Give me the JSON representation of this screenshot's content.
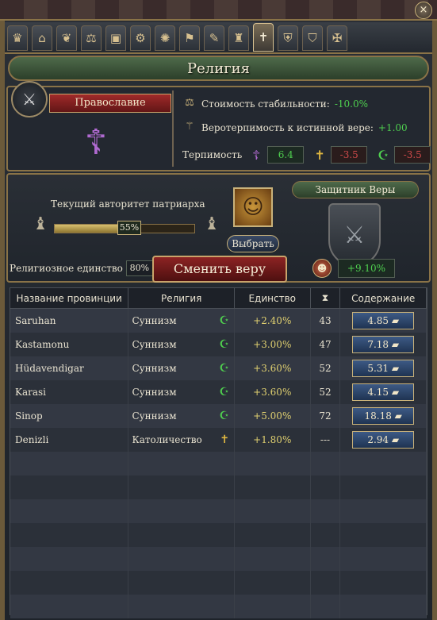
{
  "window": {
    "title": "Религия",
    "close_icon": "×"
  },
  "tabs": [
    {
      "name": "crown-icon",
      "glyph": "♛"
    },
    {
      "name": "court-icon",
      "glyph": "⌂"
    },
    {
      "name": "dove-icon",
      "glyph": "❦"
    },
    {
      "name": "trade-icon",
      "glyph": "⚖"
    },
    {
      "name": "cargo-icon",
      "glyph": "▣"
    },
    {
      "name": "gear-icon",
      "glyph": "⚙"
    },
    {
      "name": "idea-icon",
      "glyph": "✺"
    },
    {
      "name": "flag-icon",
      "glyph": "⚑"
    },
    {
      "name": "scroll-icon",
      "glyph": "✎"
    },
    {
      "name": "estates-icon",
      "glyph": "♜"
    },
    {
      "name": "religion-icon",
      "glyph": "✝",
      "active": true
    },
    {
      "name": "helmet-icon",
      "glyph": "⛨"
    },
    {
      "name": "shield-badge-icon",
      "glyph": "⛉"
    },
    {
      "name": "cross-star-icon",
      "glyph": "✠"
    }
  ],
  "religion": {
    "name": "Православие",
    "icon_glyph": "☦",
    "stability_cost_label": "Стоимость стабильности:",
    "stability_cost_value": "-10.0%",
    "true_faith_tol_label": "Веротерпимость к истинной вере:",
    "true_faith_tol_value": "+1.00",
    "tolerance_label": "Терпимость",
    "tolerances": [
      {
        "glyph": "☦",
        "value": "6.4",
        "color": "#4fd04f",
        "icon_color": "#b06ad0"
      },
      {
        "glyph": "✝",
        "value": "-3.5",
        "color": "#d04a4a",
        "icon_color": "#e0b840"
      },
      {
        "glyph": "☪",
        "value": "-3.5",
        "color": "#d04a4a",
        "icon_color": "#4fd04f"
      }
    ]
  },
  "authority": {
    "label": "Текущий авторитет патриарха",
    "percent": "55%",
    "fill_fraction": 0.55,
    "choose_label": "Выбрать",
    "defender_label": "Защитник Веры"
  },
  "unity": {
    "label": "Религиозное единство",
    "value": "80%",
    "convert_label": "Сменить веру",
    "bonus_value": "+9.10%"
  },
  "table": {
    "headers": {
      "province": "Название провинции",
      "religion": "Религия",
      "unity": "Единство",
      "time_icon": "⧗",
      "upkeep": "Содержание"
    },
    "rows": [
      {
        "province": "Saruhan",
        "religion": "Суннизм",
        "glyph": "☪",
        "glyph_color": "#4fd04f",
        "unity": "+2.40%",
        "time": "43",
        "upkeep": "4.85"
      },
      {
        "province": "Kastamonu",
        "religion": "Суннизм",
        "glyph": "☪",
        "glyph_color": "#4fd04f",
        "unity": "+3.00%",
        "time": "47",
        "upkeep": "7.18"
      },
      {
        "province": "Hüdavendigar",
        "religion": "Суннизм",
        "glyph": "☪",
        "glyph_color": "#4fd04f",
        "unity": "+3.60%",
        "time": "52",
        "upkeep": "5.31"
      },
      {
        "province": "Karasi",
        "religion": "Суннизм",
        "glyph": "☪",
        "glyph_color": "#4fd04f",
        "unity": "+3.60%",
        "time": "52",
        "upkeep": "4.15"
      },
      {
        "province": "Sinop",
        "religion": "Суннизм",
        "glyph": "☪",
        "glyph_color": "#4fd04f",
        "unity": "+5.00%",
        "time": "72",
        "upkeep": "18.18"
      },
      {
        "province": "Denizli",
        "religion": "Католичество",
        "glyph": "✝",
        "glyph_color": "#e0b840",
        "unity": "+1.80%",
        "time": "---",
        "upkeep": "2.94"
      }
    ],
    "upkeep_suffix": "▰",
    "unity_color": "#e0d070"
  }
}
